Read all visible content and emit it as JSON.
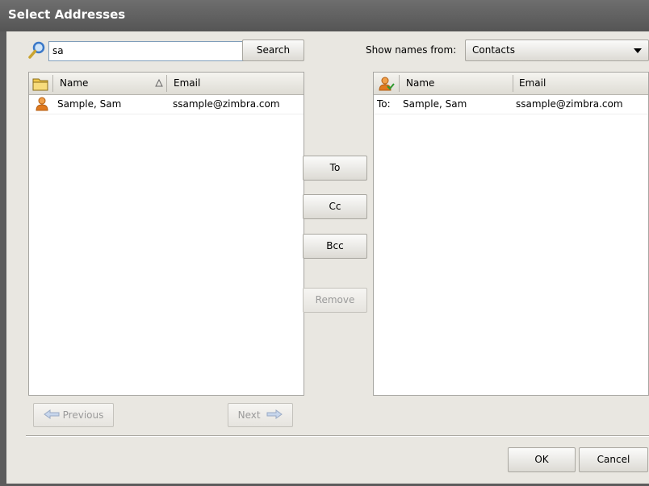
{
  "dialog": {
    "title": "Select Addresses"
  },
  "search": {
    "value": "sa",
    "button_label": "Search"
  },
  "show_names": {
    "label": "Show names from:",
    "selected": "Contacts"
  },
  "left_list": {
    "columns": {
      "name": "Name",
      "email": "Email"
    },
    "rows": [
      {
        "name": "Sample, Sam",
        "email": "ssample@zimbra.com"
      }
    ]
  },
  "pagination": {
    "previous_label": "Previous",
    "next_label": "Next"
  },
  "actions": {
    "to": "To",
    "cc": "Cc",
    "bcc": "Bcc",
    "remove": "Remove"
  },
  "right_list": {
    "columns": {
      "name": "Name",
      "email": "Email"
    },
    "rows": [
      {
        "type": "To:",
        "name": "Sample, Sam",
        "email": "ssample@zimbra.com"
      }
    ]
  },
  "footer": {
    "ok": "OK",
    "cancel": "Cancel"
  },
  "colors": {
    "titlebar": "#5f5f5f",
    "contact_icon": "#e07a1f",
    "magnifier": "#3a78c8"
  }
}
